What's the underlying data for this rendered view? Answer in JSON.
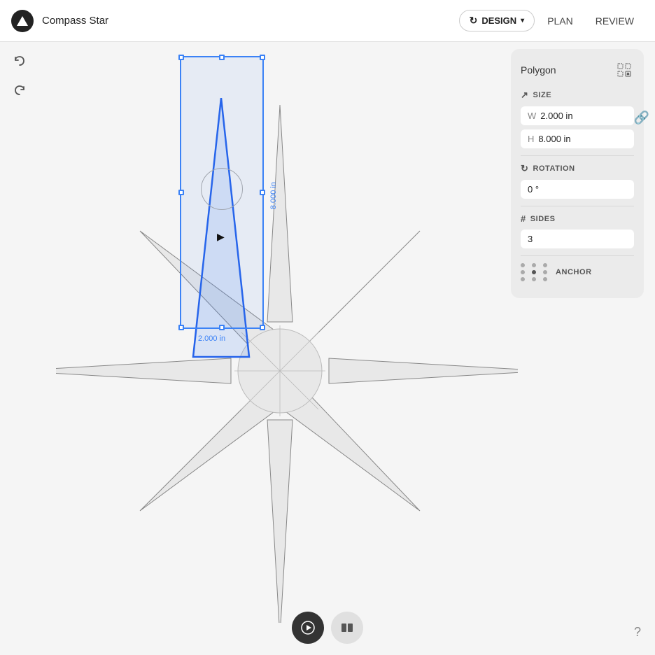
{
  "app": {
    "title": "Compass Star",
    "logo_label": "triangle-logo"
  },
  "header": {
    "design_label": "DESIGN",
    "plan_label": "PLAN",
    "review_label": "REVIEW"
  },
  "tools": {
    "undo_label": "undo",
    "redo_label": "redo"
  },
  "canvas": {
    "dimension_height": "8.000 in",
    "dimension_width": "2.000 in"
  },
  "panel": {
    "title": "Polygon",
    "size_label": "SIZE",
    "width_prefix": "W",
    "width_value": "2.000 in",
    "height_prefix": "H",
    "height_value": "8.000 in",
    "rotation_label": "ROTATION",
    "rotation_value": "0 °",
    "sides_label": "SIDES",
    "sides_value": "3",
    "anchor_label": "ANCHOR"
  },
  "bottom": {
    "play_label": "play",
    "split_label": "split",
    "help_label": "?"
  }
}
